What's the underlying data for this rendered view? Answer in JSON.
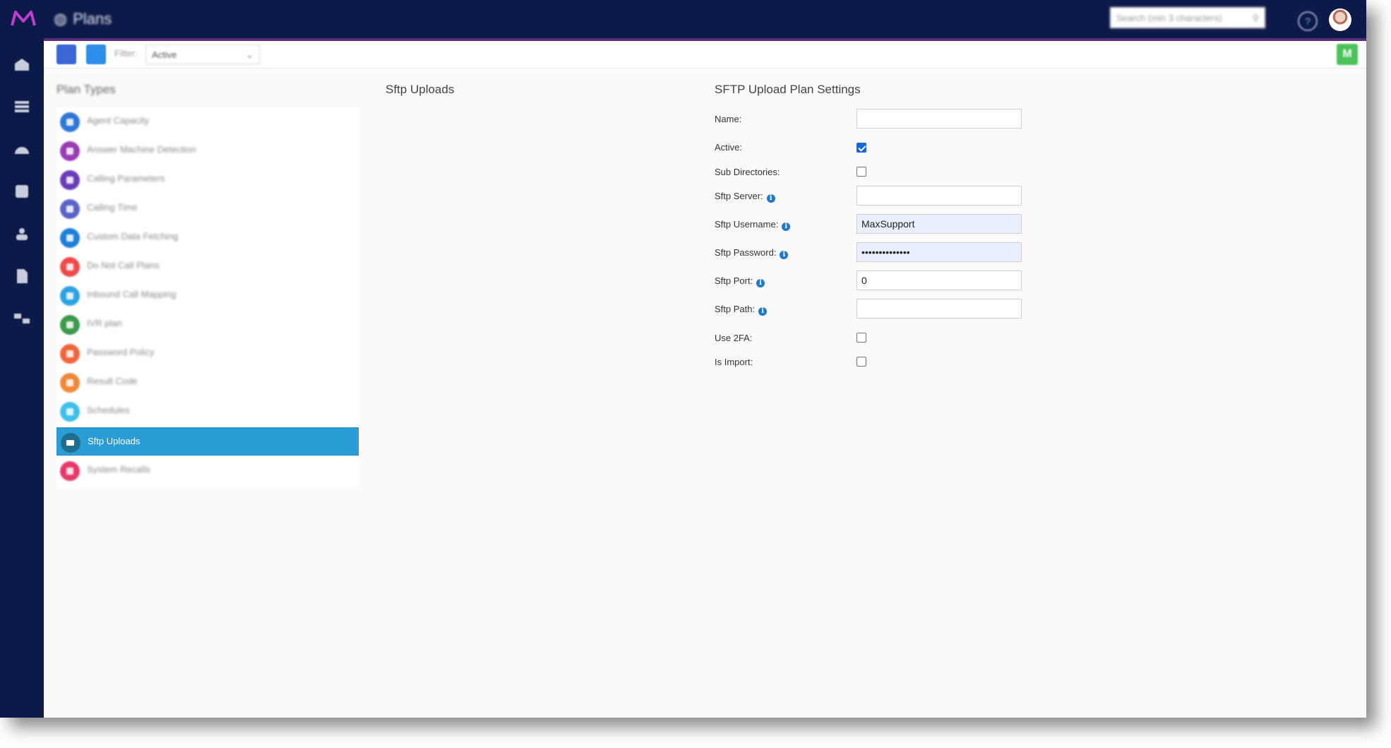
{
  "app": {
    "title": "Plans",
    "title_icon": "globe-icon",
    "search_placeholder": "Search (min 3 characters)"
  },
  "nav": {
    "icons": [
      "home-icon",
      "grid-icon",
      "gauge-icon",
      "database-icon",
      "users-icon",
      "document-icon",
      "sitemap-icon"
    ]
  },
  "toolbar": {
    "filter_label": "Filter:",
    "filter_value": "Active",
    "right_button": "M"
  },
  "plan_types": {
    "title": "Plan Types",
    "selected": "Sftp Uploads",
    "items": [
      {
        "label": "Agent Capacity",
        "color": "#2f78d8"
      },
      {
        "label": "Answer Machine Detection",
        "color": "#9c3cb5"
      },
      {
        "label": "Calling Parameters",
        "color": "#6a3cb8"
      },
      {
        "label": "Calling Time",
        "color": "#5a64c8"
      },
      {
        "label": "Custom Data Fetching",
        "color": "#1f7fd9"
      },
      {
        "label": "Do Not Call Plans",
        "color": "#ef4a4a"
      },
      {
        "label": "Inbound Call Mapping",
        "color": "#2ea3e3"
      },
      {
        "label": "IVR plan",
        "color": "#3a9a4a"
      },
      {
        "label": "Password Policy",
        "color": "#f0663a"
      },
      {
        "label": "Result Code",
        "color": "#f08a3a"
      },
      {
        "label": "Schedules",
        "color": "#3ec0e8"
      },
      {
        "label": "Sftp Uploads",
        "color": "#1e6f8f"
      },
      {
        "label": "System Recalls",
        "color": "#e83a6a"
      }
    ]
  },
  "middle": {
    "title": "Sftp Uploads"
  },
  "settings": {
    "title": "SFTP Upload Plan Settings",
    "fields": {
      "name": {
        "label": "Name:",
        "value": ""
      },
      "active": {
        "label": "Active:",
        "checked": true
      },
      "sub_directories": {
        "label": "Sub Directories:",
        "checked": false
      },
      "sftp_server": {
        "label": "Sftp Server:",
        "value": ""
      },
      "sftp_username": {
        "label": "Sftp Username:",
        "value": "MaxSupport"
      },
      "sftp_password": {
        "label": "Sftp Password:",
        "value": "••••••••••••••"
      },
      "sftp_port": {
        "label": "Sftp Port:",
        "value": "0"
      },
      "sftp_path": {
        "label": "Sftp Path:",
        "value": ""
      },
      "use_2fa": {
        "label": "Use 2FA:",
        "checked": false
      },
      "is_import": {
        "label": "Is Import:",
        "checked": false
      }
    }
  }
}
